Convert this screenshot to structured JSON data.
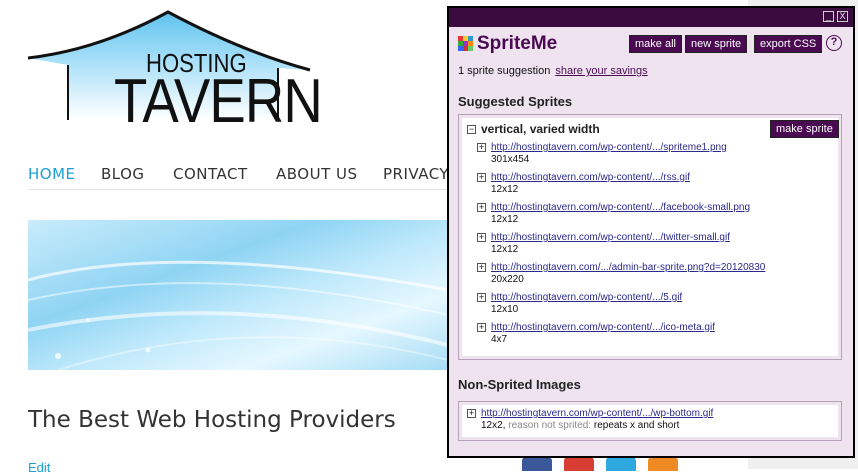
{
  "site": {
    "logo": {
      "line1": "HOSTING",
      "line2": "TAVERN"
    },
    "nav": [
      {
        "label": "HOME",
        "active": true
      },
      {
        "label": "BLOG",
        "active": false
      },
      {
        "label": "CONTACT",
        "active": false
      },
      {
        "label": "ABOUT US",
        "active": false
      },
      {
        "label": "PRIVACY",
        "active": false
      }
    ],
    "page_title": "The Best Web Hosting Providers",
    "edit_link": "Edit",
    "accent_color": "#1aa0d8"
  },
  "spriteme": {
    "title": "SpriteMe",
    "buttons": {
      "make_all": "make all",
      "new_sprite": "new sprite",
      "export_css": "export CSS",
      "help": "?"
    },
    "window_controls": {
      "minimize": "_",
      "close": "X"
    },
    "summary": {
      "text": "1 sprite suggestion",
      "link": "share your savings"
    },
    "suggested_title": "Suggested Sprites",
    "group": {
      "toggle": "−",
      "label": "vertical, varied width",
      "make_sprite": "make sprite",
      "images": [
        {
          "url": "http://hostingtavern.com/wp-content/.../spriteme1.png",
          "dims": "301x454"
        },
        {
          "url": "http://hostingtavern.com/wp-content/.../rss.gif",
          "dims": "12x12"
        },
        {
          "url": "http://hostingtavern.com/wp-content/.../facebook-small.png",
          "dims": "12x12"
        },
        {
          "url": "http://hostingtavern.com/wp-content/.../twitter-small.gif",
          "dims": "12x12"
        },
        {
          "url": "http://hostingtavern.com/.../admin-bar-sprite.png?d=20120830",
          "dims": "20x220"
        },
        {
          "url": "http://hostingtavern.com/wp-content/.../5.gif",
          "dims": "12x10"
        },
        {
          "url": "http://hostingtavern.com/wp-content/.../ico-meta.gif",
          "dims": "4x7"
        }
      ]
    },
    "non_sprited_title": "Non-Sprited Images",
    "non_sprited": [
      {
        "url": "http://hostingtavern.com/wp-content/.../wp-bottom.gif",
        "dims": "12x2,",
        "reason_label": "reason not sprited:",
        "reason": "repeats x and short"
      }
    ],
    "colors": {
      "brand": "#4a0a52",
      "titlebar": "#3b0a3f",
      "panel_bg": "#efe3f0"
    }
  }
}
